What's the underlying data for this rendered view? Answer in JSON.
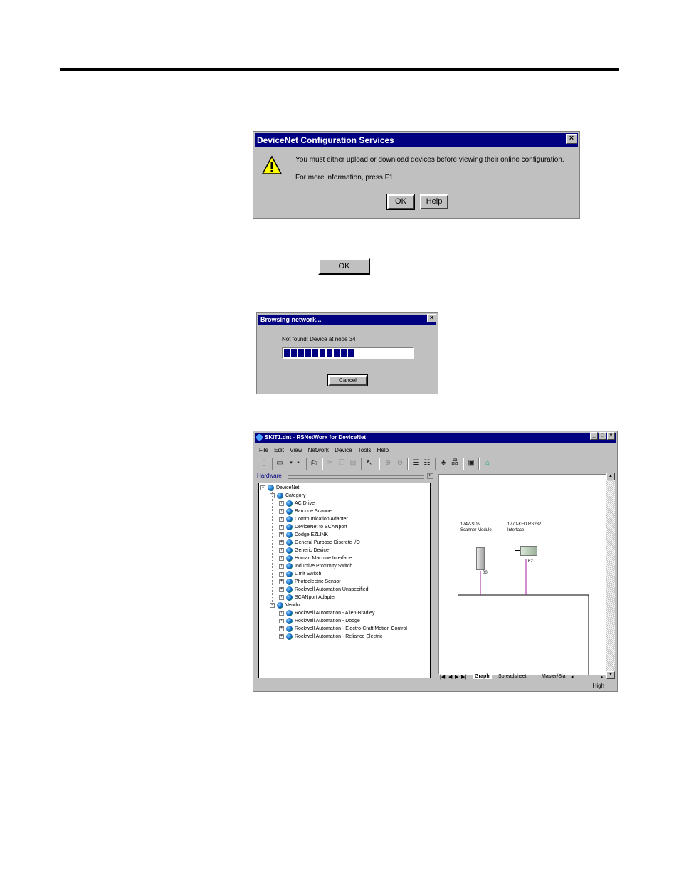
{
  "dialog1": {
    "title": "DeviceNet Configuration Services",
    "close": "×",
    "message": "You must either upload or download devices before viewing their online configuration.",
    "info": "For more information, press F1",
    "ok": "OK",
    "help": "Help"
  },
  "ok_standalone": "OK",
  "dialog2": {
    "title": "Browsing network...",
    "close": "×",
    "status": "Not found: Device at node 34",
    "progress": 0.57,
    "cancel": "Cancel"
  },
  "app": {
    "title": "SKIT1.dnt - RSNetWorx for DeviceNet",
    "win_buttons": [
      "_",
      "□",
      "×"
    ],
    "menu": [
      "File",
      "Edit",
      "View",
      "Network",
      "Device",
      "Tools",
      "Help"
    ],
    "hardware_label": "Hardware",
    "hw_close": "×",
    "tree": {
      "root": "DeviceNet",
      "category": "Category",
      "category_items": [
        "AC Drive",
        "Barcode Scanner",
        "Communication Adapter",
        "DeviceNet to SCANport",
        "Dodge EZLINK",
        "General Purpose Discrete I/O",
        "Generic Device",
        "Human Machine Interface",
        "Inductive Proximity Switch",
        "Limit Switch",
        "Photoelectric Sensor",
        "Rockwell Automation Unspecified",
        "SCANport Adapter"
      ],
      "vendor": "Vendor",
      "vendor_items": [
        "Rockwell Automation - Allen-Bradley",
        "Rockwell Automation - Dodge",
        "Rockwell Automation - Electro-Craft Motion Control",
        "Rockwell Automation - Reliance Electric"
      ]
    },
    "graph": {
      "device1_line1": "1747-SDN",
      "device1_line2": "Scanner Module",
      "device1_node": "00",
      "device2_line1": "1770-KFD RS232",
      "device2_line2": "Interface",
      "device2_node": "62"
    },
    "tabs": [
      "Graph",
      "Spreadsheet",
      "Master/Sla"
    ],
    "status": "High"
  }
}
